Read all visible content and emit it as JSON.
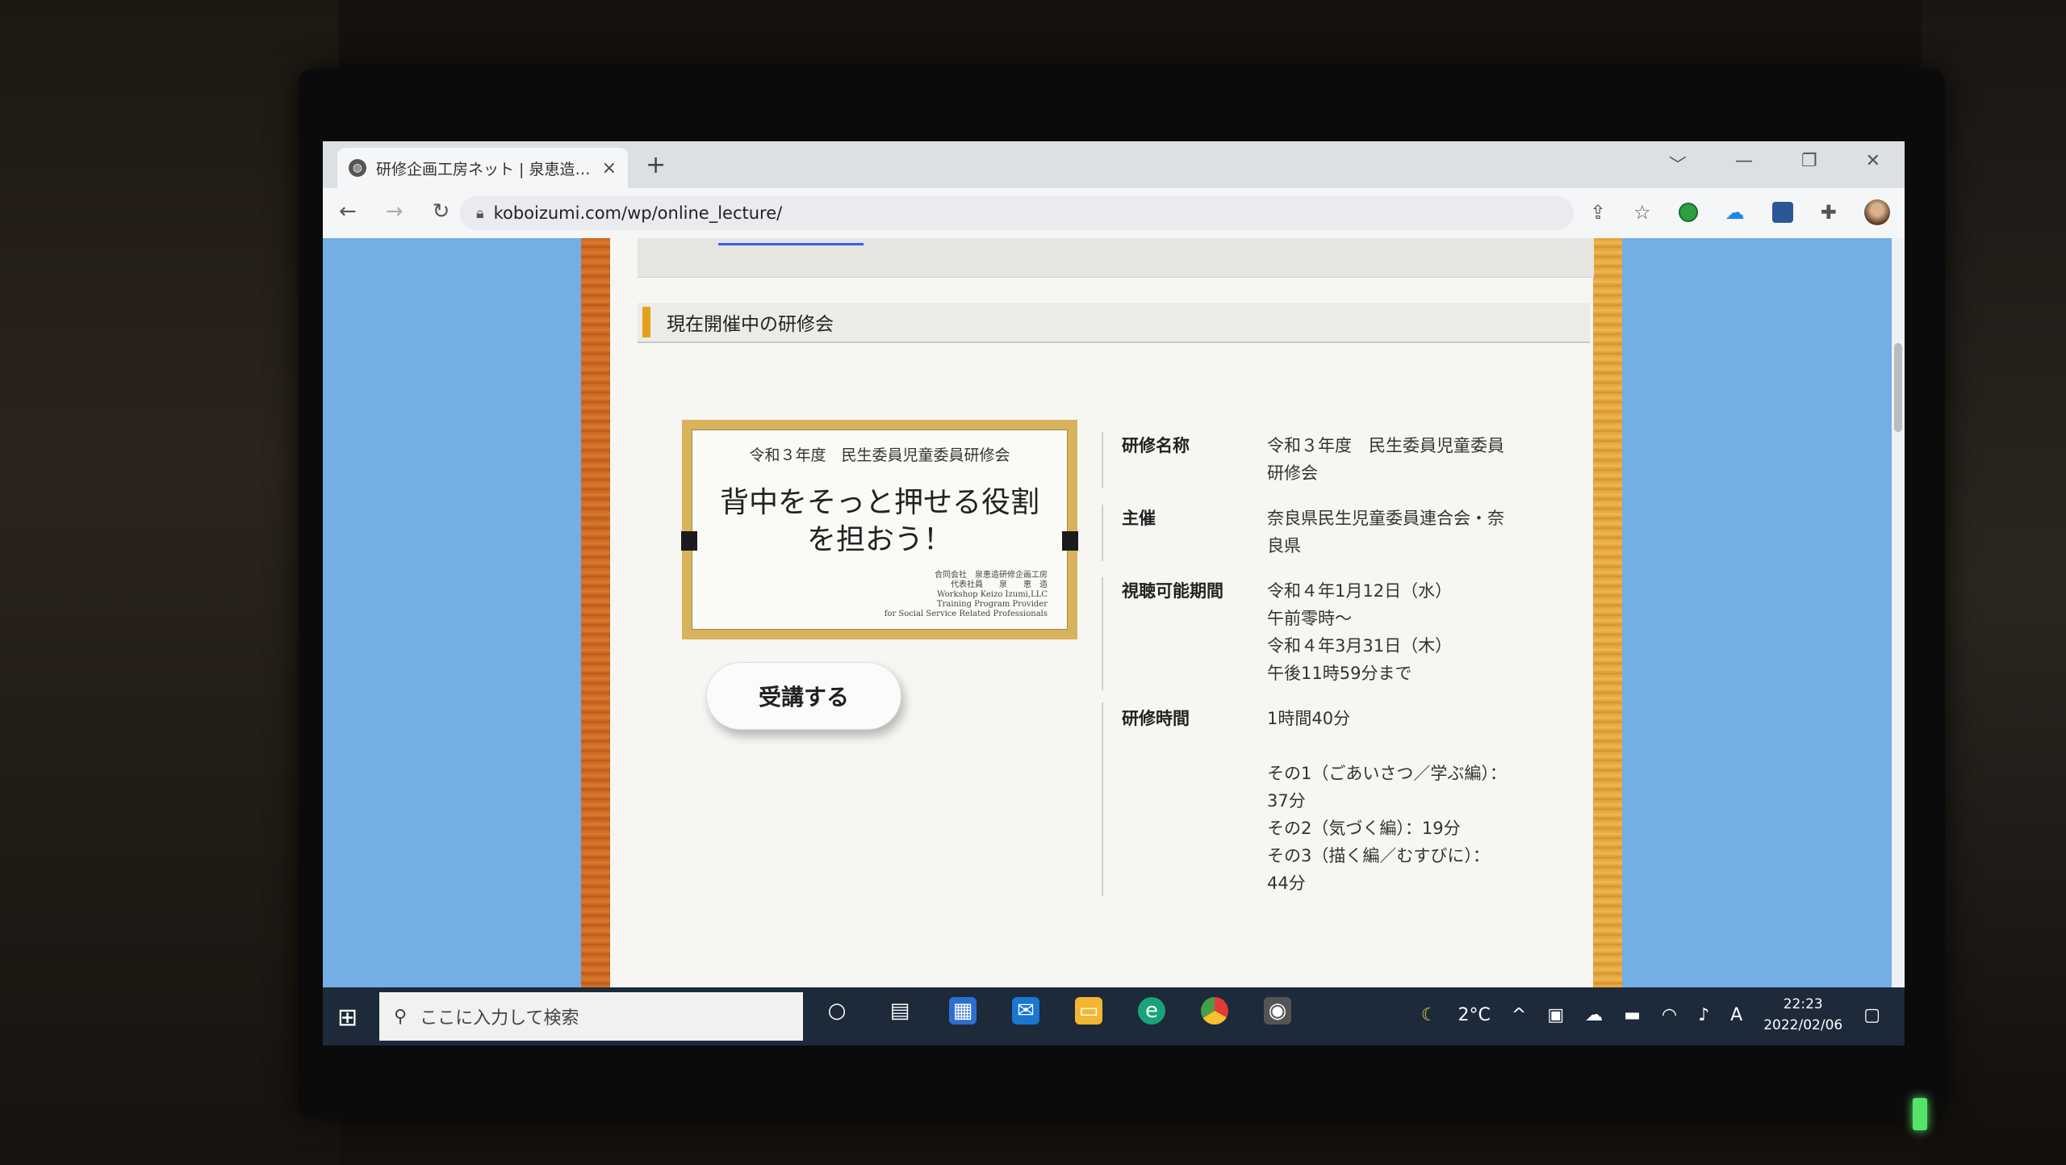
{
  "browser": {
    "tab_title": "研修企画工房ネット | 泉恵造研修企画工房",
    "new_tab": "+",
    "tab_close": "×",
    "url": "koboizumi.com/wp/online_lecture/",
    "window_controls": [
      "﹀",
      "—",
      "❐",
      "✕"
    ]
  },
  "page": {
    "section_heading": "現在開催中の研修会",
    "banner": {
      "year_line": "令和３年度　民生委員児童委員研修会",
      "main_line1": "背中をそっと押せる役割",
      "main_line2": "を担おう！",
      "org_lines": [
        "合同会社　泉恵造研修企画工房",
        "代表社員　　泉　　恵　造",
        "Workshop Keizo Izumi,LLC",
        "Training Program Provider",
        "for Social Service Related Professionals"
      ]
    },
    "enroll_button": "受講する",
    "info": {
      "name_label": "研修名称",
      "name_value_1": "令和３年度　民生委員児童委員",
      "name_value_2": "研修会",
      "host_label": "主催",
      "host_value_1": "奈良県民生児童委員連合会・奈",
      "host_value_2": "良県",
      "period_label": "視聴可能期間",
      "period_lines": [
        "令和４年1月12日（水）",
        "午前零時～",
        "令和４年3月31日（木）",
        "午後11時59分まで"
      ],
      "duration_label": "研修時間",
      "duration_value": "1時間40分",
      "parts": [
        "その1（ごあいさつ／学ぶ編）：",
        "37分",
        "その2（気づく編）：19分",
        "その3（描く編／むすびに）：",
        "44分"
      ]
    }
  },
  "taskbar": {
    "search_placeholder": "ここに入力して検索",
    "weather": "2°C",
    "ime": "A",
    "time": "22:23",
    "date": "2022/02/06"
  }
}
